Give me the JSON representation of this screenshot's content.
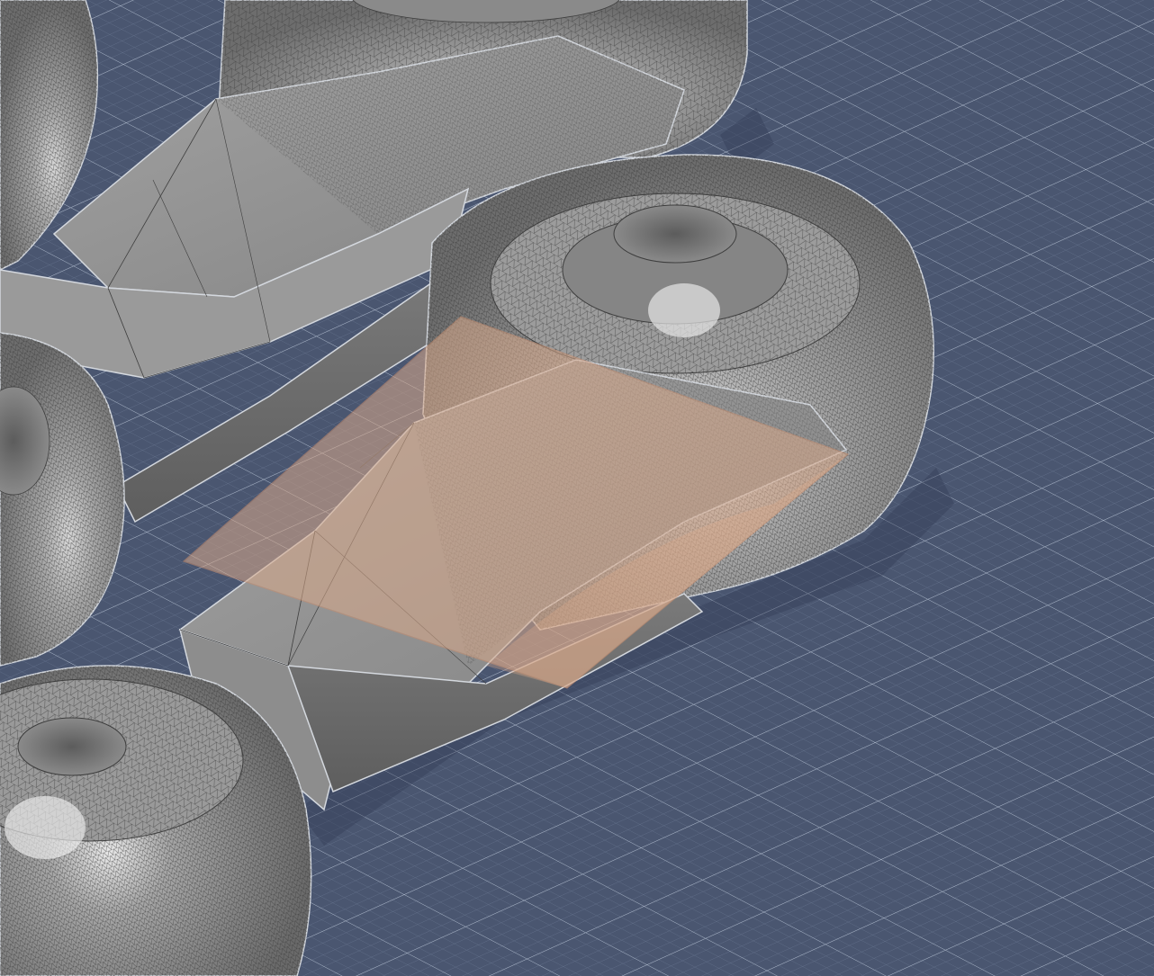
{
  "viewport": {
    "background": "#4a5670",
    "grid_minor_color": "#6a7892",
    "grid_major_color": "#c9d1de"
  },
  "model": {
    "body_color": "#8f8f8f",
    "body_light": "#b4b4b4",
    "body_dark": "#6f6f6f",
    "mesh_line_color": "#3e3e3e",
    "outline_color": "#d4d8de",
    "highlight_color": "#ffffff"
  },
  "section_plane": {
    "color": "#d9a98a",
    "opacity": 0.55,
    "border_color": "#c98e6e"
  }
}
